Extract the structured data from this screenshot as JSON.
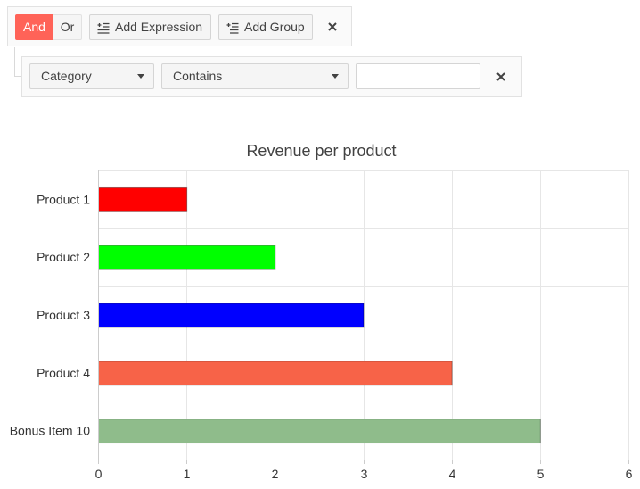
{
  "filter": {
    "logic": {
      "and_label": "And",
      "or_label": "Or",
      "selected": "And"
    },
    "add_expression_label": "Add Expression",
    "add_group_label": "Add Group",
    "expression": {
      "field": "Category",
      "operator": "Contains",
      "value": ""
    }
  },
  "colors": {
    "accent": "#ff6358"
  },
  "chart_data": {
    "type": "bar",
    "orientation": "horizontal",
    "title": "Revenue per product",
    "categories": [
      "Product 1",
      "Product 2",
      "Product 3",
      "Product 4",
      "Bonus Item 10"
    ],
    "values": [
      1,
      2,
      3,
      4,
      5
    ],
    "colors": [
      "#ff0000",
      "#00ff00",
      "#0000ff",
      "#f76348",
      "#8fbc8b"
    ],
    "xlim": [
      0,
      6
    ],
    "xticks": [
      0,
      1,
      2,
      3,
      4,
      5,
      6
    ],
    "grid": true,
    "legend": "none"
  }
}
